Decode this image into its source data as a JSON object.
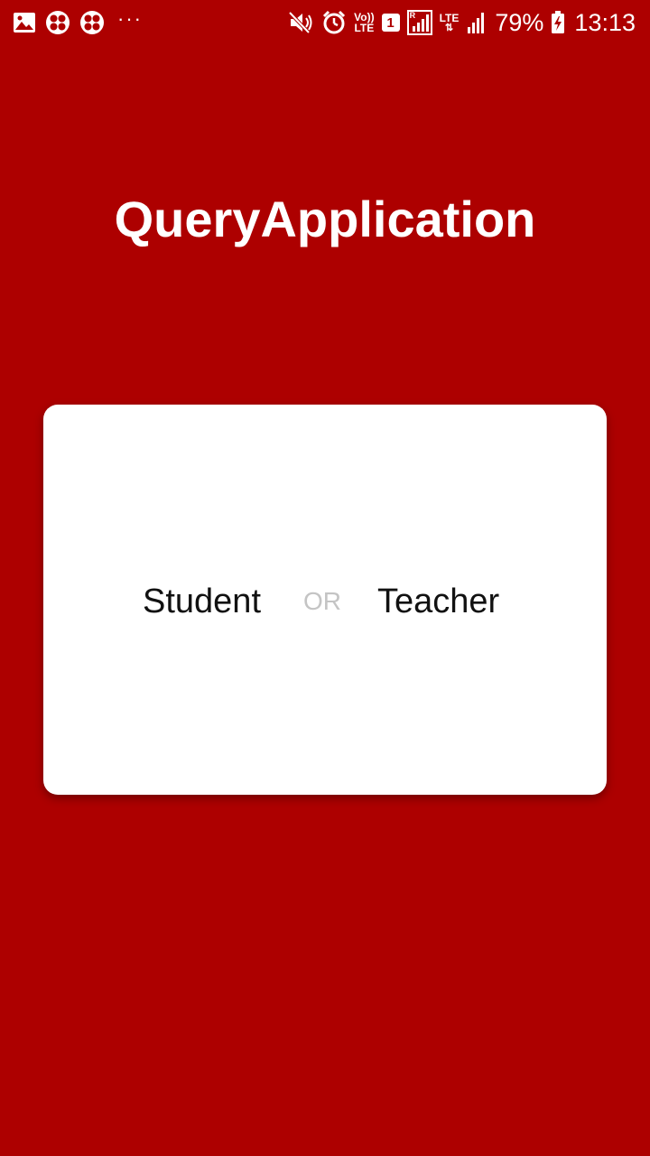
{
  "status_bar": {
    "left_icons": [
      "gallery-icon",
      "app-icon",
      "app-icon",
      "more-notifications-icon"
    ],
    "right_icons": [
      "mute-icon",
      "alarm-icon",
      "volte-icon",
      "sim-1-icon",
      "roaming-signal-icon",
      "lte-icon",
      "signal-icon",
      "battery-icon"
    ],
    "volte_top": "Vo))",
    "volte_bottom": "LTE",
    "sim_number": "1",
    "lte_label": "LTE",
    "roaming_label": "R",
    "battery_percent": "79%",
    "time": "13:13",
    "more_dots": "···"
  },
  "app": {
    "title": "QueryApplication"
  },
  "card": {
    "student_label": "Student",
    "or_label": "OR",
    "teacher_label": "Teacher"
  },
  "colors": {
    "background": "#AD0000",
    "card": "#FFFFFF",
    "or_text": "#C4C4C4"
  }
}
